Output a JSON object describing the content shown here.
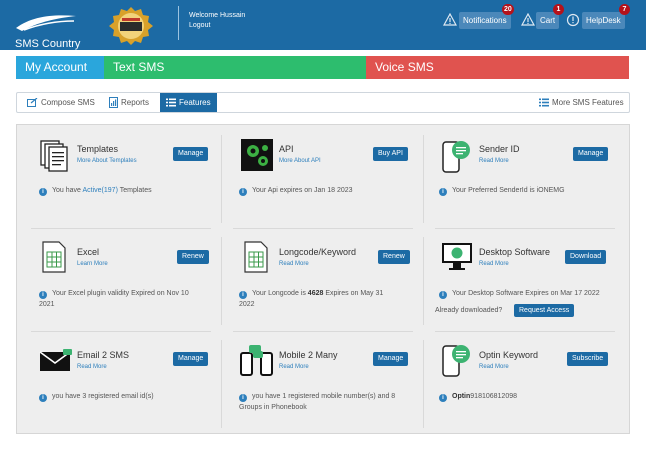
{
  "header": {
    "logo_text": "SMS Country",
    "award_text": "IFAQ 200",
    "welcome": "Welcome Hussain",
    "logout": "Logout",
    "notifications_label": "Notifications",
    "notifications_count": "20",
    "cart_label": "Cart",
    "cart_count": "1",
    "helpdesk_label": "HelpDesk",
    "helpdesk_count": "7"
  },
  "account_tabs": {
    "my_account": "My Account",
    "text_sms": "Text SMS",
    "voice_sms": "Voice SMS"
  },
  "sub_tabs": {
    "compose": "Compose SMS",
    "reports": "Reports",
    "features": "Features",
    "more": "More SMS Features"
  },
  "cards": {
    "templates": {
      "title": "Templates",
      "link": "More About Templates",
      "button": "Manage",
      "info_prefix": "You have ",
      "info_highlight": "Active(197)",
      "info_suffix": " Templates"
    },
    "api": {
      "title": "API",
      "link": "More About API",
      "button": "Buy API",
      "info": "Your Api expires on Jan 18 2023"
    },
    "sender_id": {
      "title": "Sender ID",
      "link": "Read More",
      "button": "Manage",
      "info": "Your Preferred SenderId is iONEMG"
    },
    "excel": {
      "title": "Excel",
      "link": "Learn More",
      "button": "Renew",
      "info_line1": "Your Excel plugin validity Expired on Nov 10",
      "info_line2": "2021"
    },
    "longcode": {
      "title": "Longcode/Keyword",
      "link": "Read More",
      "button": "Renew",
      "info_prefix": "Your Longcode is ",
      "info_bold": "4628",
      "info_suffix": " Expires on May 31",
      "info_line2": "2022"
    },
    "desktop": {
      "title": "Desktop Software",
      "link": "Read More",
      "button": "Download",
      "info": "Your Desktop Software Expires on Mar 17 2022",
      "already": "Already downloaded?",
      "request_button": "Request Access"
    },
    "email2sms": {
      "title": "Email 2 SMS",
      "link": "Read More",
      "button": "Manage",
      "info": "you have 3 registered email id(s)"
    },
    "mobile2many": {
      "title": "Mobile 2 Many",
      "link": "Read More",
      "button": "Manage",
      "info_line1": "you have 1 registered mobile number(s) and 8",
      "info_line2": "Groups in Phonebook"
    },
    "optin": {
      "title": "Optin Keyword",
      "link": "Read More",
      "button": "Subscribe",
      "info_bold": "Optin",
      "info_value": "918106812098"
    }
  },
  "colors": {
    "header_bg": "#1c6aa4",
    "my_account": "#2aa6dc",
    "text_sms": "#2dbd6e",
    "voice_sms": "#e0534f",
    "link": "#2d7fbc",
    "badge": "#b5121b"
  },
  "icons": {
    "templates": "documents-icon",
    "api": "gears-icon",
    "sender_id": "phone-chat-icon",
    "excel": "spreadsheet-icon",
    "longcode": "spreadsheet-icon",
    "desktop": "monitor-icon",
    "email2sms": "envelope-icon",
    "mobile2many": "phones-icon",
    "optin": "phone-chat-icon"
  }
}
